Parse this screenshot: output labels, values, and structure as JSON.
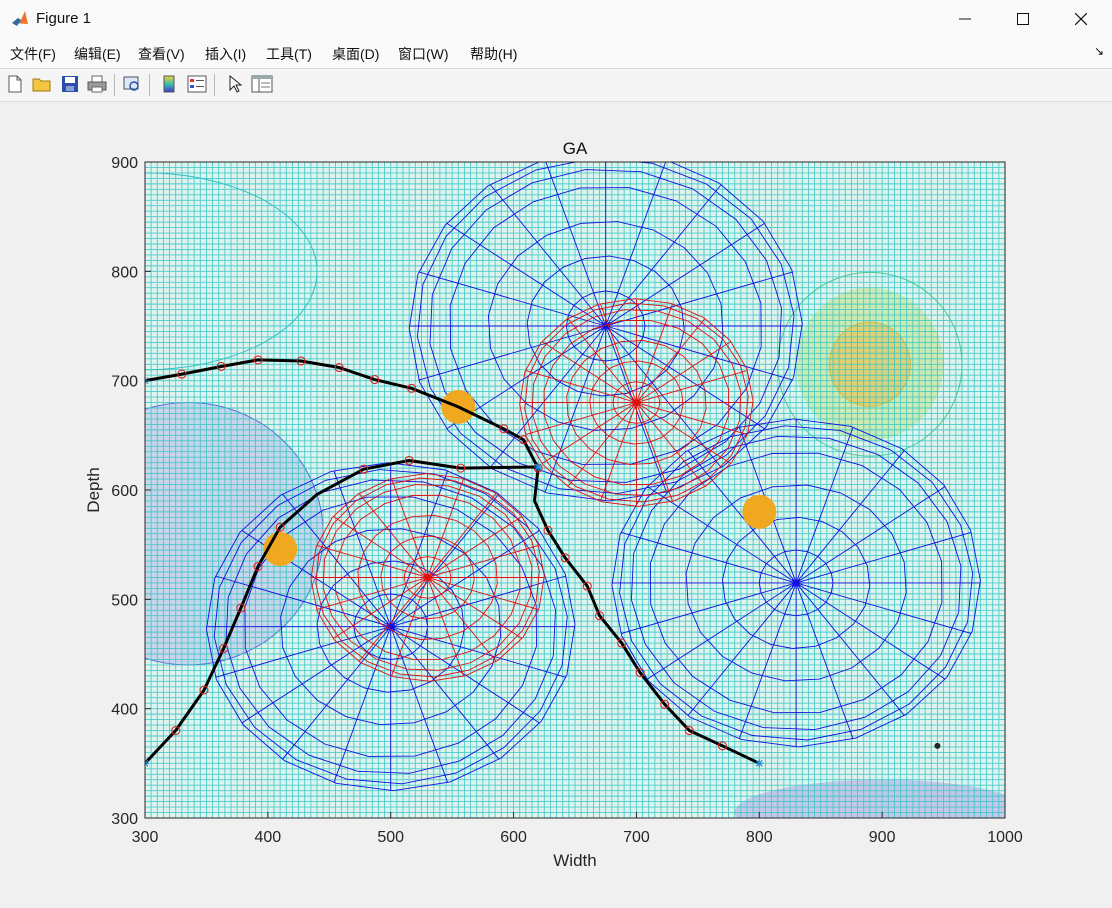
{
  "window": {
    "title": "Figure 1"
  },
  "menu": [
    "文件(F)",
    "编辑(E)",
    "查看(V)",
    "插入(I)",
    "工具(T)",
    "桌面(D)",
    "窗口(W)",
    "帮助(H)"
  ],
  "toolbar": [
    "new-file-icon",
    "open-folder-icon",
    "save-icon",
    "print-icon",
    "print-preview-icon",
    "colorbar-icon",
    "legend-icon",
    "pointer-icon",
    "property-editor-icon"
  ],
  "chart_data": {
    "type": "line",
    "title": "GA",
    "xlabel": "Width",
    "ylabel": "Depth",
    "xlim": [
      300,
      1000
    ],
    "ylim": [
      300,
      900
    ],
    "xticks": [
      300,
      400,
      500,
      600,
      700,
      800,
      900,
      1000
    ],
    "yticks": [
      300,
      400,
      500,
      600,
      700,
      800,
      900
    ],
    "grid_spacing": 5,
    "background_colors": {
      "grid": "#33c4c4",
      "low": "#6a4dd6",
      "high": "#f2b333"
    },
    "threat_zones": [
      {
        "center": [
          500,
          475
        ],
        "radius": 150,
        "color": "#1010e0"
      },
      {
        "center": [
          675,
          750
        ],
        "radius": 160,
        "color": "#1010e0"
      },
      {
        "center": [
          830,
          515
        ],
        "radius": 150,
        "color": "#1010e0"
      },
      {
        "center": [
          530,
          520
        ],
        "radius": 95,
        "color": "#e01010"
      },
      {
        "center": [
          700,
          680
        ],
        "radius": 95,
        "color": "#e01010"
      }
    ],
    "hotspot": {
      "center": [
        890,
        715
      ],
      "rx": 60,
      "ry": 70
    },
    "obstacles": [
      [
        555,
        676
      ],
      [
        410,
        546
      ],
      [
        800,
        580
      ]
    ],
    "obstacle_color": "#f0a820",
    "marker_point": [
      945,
      366
    ],
    "series": [
      {
        "color": "#000000",
        "x": [
          300,
          330,
          362,
          392,
          427,
          458,
          487,
          517,
          555,
          592,
          608,
          620,
          617,
          628,
          642,
          660,
          670,
          688,
          703,
          723,
          743,
          770,
          800
        ],
        "y": [
          700,
          706,
          713,
          719,
          718,
          712,
          701,
          693,
          676,
          656,
          646,
          620,
          590,
          563,
          538,
          512,
          485,
          460,
          433,
          404,
          380,
          366,
          350
        ],
        "waypoints_x": [
          330,
          362,
          392,
          427,
          458,
          487,
          517,
          592,
          608,
          620,
          628,
          642,
          660,
          670,
          688,
          703,
          723,
          743,
          770
        ],
        "waypoints_y": [
          706,
          713,
          719,
          718,
          712,
          701,
          693,
          656,
          646,
          620,
          563,
          538,
          512,
          485,
          460,
          433,
          404,
          380,
          366
        ]
      },
      {
        "color": "#000000",
        "x": [
          300,
          325,
          348,
          364,
          378,
          392,
          410,
          440,
          478,
          515,
          557,
          620
        ],
        "y": [
          350,
          380,
          417,
          455,
          492,
          530,
          566,
          596,
          619,
          627,
          620,
          621
        ],
        "waypoints_x": [
          325,
          348,
          364,
          378,
          392,
          410,
          478,
          515,
          557
        ],
        "waypoints_y": [
          380,
          417,
          455,
          492,
          530,
          566,
          619,
          627,
          620
        ]
      }
    ],
    "waypoint_color": "#e02020",
    "endpoint_color": "#1a8fd6"
  }
}
